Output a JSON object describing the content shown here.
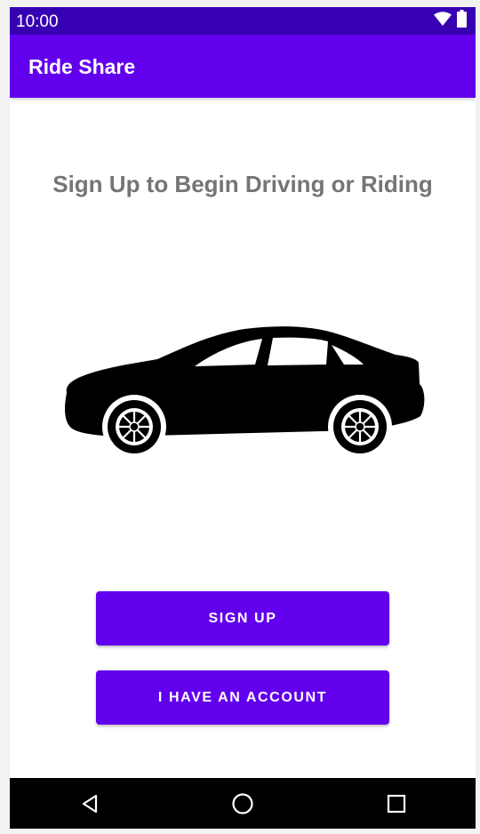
{
  "status_bar": {
    "time": "10:00",
    "icons": [
      "wifi-icon",
      "battery-icon"
    ]
  },
  "app_bar": {
    "title": "Ride Share"
  },
  "main": {
    "headline": "Sign Up to Begin Driving or Riding",
    "illustration": "car-icon",
    "buttons": {
      "sign_up": "SIGN UP",
      "have_account": "I HAVE AN ACCOUNT"
    }
  },
  "nav_bar": {
    "icons": [
      "back-icon",
      "home-icon",
      "recent-apps-icon"
    ]
  },
  "colors": {
    "primary": "#6200ee",
    "primary_dark": "#3700b3",
    "headline_text": "#757575",
    "nav_bar": "#000000"
  }
}
